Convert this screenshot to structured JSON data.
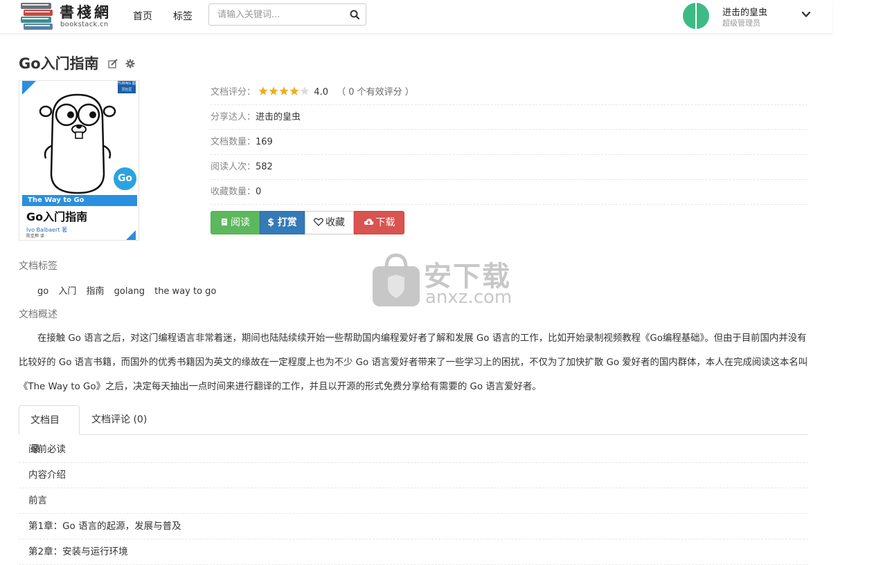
{
  "header": {
    "logo_text": "書棧網",
    "logo_url": "bookstack.cn",
    "nav_home": "首页",
    "nav_tags": "标签",
    "search_placeholder": "请输入关键词...",
    "user_name": "进击的皇虫",
    "user_role": "超级管理员",
    "avatar_color": "#3dbb86"
  },
  "book": {
    "title": "Go入门指南",
    "cover": {
      "band_text": "The Way to Go",
      "title": "Go入门指南",
      "go_badge": "Go",
      "publisher_badge": "TURING 图灵社区",
      "author": "Ivo Balbaert 著",
      "translator": "陈佳桦 译"
    },
    "info": {
      "rating_label": "文档评分：",
      "rating_stars": 4.0,
      "rating_value": "4.0",
      "rating_count": "（ 0 个有效评分 ）",
      "sharer_label": "分享达人：",
      "sharer_value": "进击的皇虫",
      "doc_count_label": "文档数量：",
      "doc_count_value": "169",
      "read_count_label": "阅读人次：",
      "read_count_value": "582",
      "fav_count_label": "收藏数量：",
      "fav_count_value": "0"
    },
    "buttons": {
      "read": "阅读",
      "tip": "打赏",
      "favorite": "收藏",
      "download": "下载"
    }
  },
  "tags_section": {
    "label": "文档标签",
    "items": [
      "go",
      "入门",
      "指南",
      "golang",
      "the way to go"
    ]
  },
  "summary_section": {
    "label": "文档概述",
    "text": "在接触 Go 语言之后，对这门编程语言非常着迷，期间也陆陆续续开始一些帮助国内编程爱好者了解和发展 Go 语言的工作，比如开始录制视频教程《Go编程基础》。但由于目前国内并没有比较好的 Go 语言书籍，而国外的优秀书籍因为英文的缘故在一定程度上也为不少 Go 语言爱好者带来了一些学习上的困扰，不仅为了加快扩散 Go 爱好者的国内群体，本人在完成阅读这本名叫《The Way to Go》之后，决定每天抽出一点时间来进行翻译的工作，并且以开源的形式免费分享给有需要的 Go 语言爱好者。"
  },
  "tabs": {
    "toc": "文档目录",
    "comments": "文档评论 (0)"
  },
  "toc_items": [
    "阅前必读",
    "内容介绍",
    "前言",
    "第1章：Go 语言的起源，发展与普及",
    "第2章：安装与运行环境"
  ],
  "watermark": {
    "text": "安下载",
    "url": "anxz.com"
  },
  "colors": {
    "read_button": "#5cb85c",
    "tip_button": "#337ab7",
    "download_button": "#d9534f",
    "star": "#f0ad1e"
  }
}
